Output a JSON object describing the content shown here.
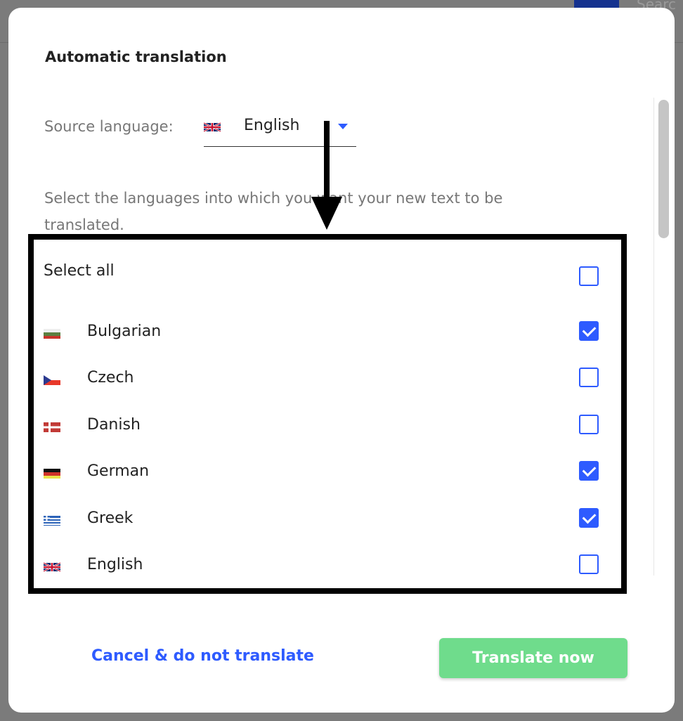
{
  "background": {
    "search_placeholder": "Searc"
  },
  "dialog": {
    "title": "Automatic translation",
    "source_language_label": "Source language:",
    "source_language_value": "English",
    "hint": "Select the languages into which you want your new text to be translated.",
    "select_all_label": "Select all",
    "select_all_checked": false,
    "languages": [
      {
        "name": "Bulgarian",
        "flag": "flag-bg",
        "checked": true
      },
      {
        "name": "Czech",
        "flag": "flag-cz",
        "checked": false
      },
      {
        "name": "Danish",
        "flag": "flag-dk",
        "checked": false
      },
      {
        "name": "German",
        "flag": "flag-de",
        "checked": true
      },
      {
        "name": "Greek",
        "flag": "flag-gr",
        "checked": true
      },
      {
        "name": "English",
        "flag": "flag-gb",
        "checked": false
      }
    ],
    "cancel_label": "Cancel & do not translate",
    "translate_label": "Translate now"
  },
  "colors": {
    "accent": "#2e5bff",
    "primary_button": "#6fdc8c",
    "annotation": "#000000"
  }
}
